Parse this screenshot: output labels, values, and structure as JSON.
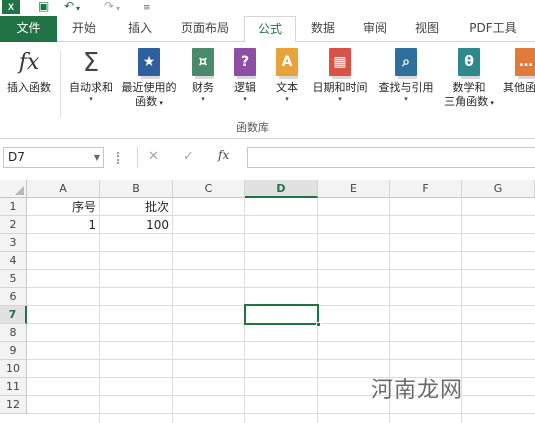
{
  "quick_access": {
    "app_icon": "excel-icon",
    "icons": [
      "save-icon",
      "undo-icon",
      "redo-icon",
      "customize-icon"
    ]
  },
  "tabs": [
    {
      "label": "文件",
      "state": "file"
    },
    {
      "label": "开始",
      "state": ""
    },
    {
      "label": "插入",
      "state": ""
    },
    {
      "label": "页面布局",
      "state": ""
    },
    {
      "label": "公式",
      "state": "active"
    },
    {
      "label": "数据",
      "state": ""
    },
    {
      "label": "审阅",
      "state": ""
    },
    {
      "label": "视图",
      "state": ""
    },
    {
      "label": "PDF工具",
      "state": ""
    }
  ],
  "ribbon": {
    "insert_function": {
      "icon_text": "fx",
      "label": "插入函数"
    },
    "autosum": {
      "icon_text": "Σ",
      "label": "自动求和"
    },
    "recent": {
      "icon_text": "★",
      "label1": "最近使用的",
      "label2": "函数"
    },
    "financial": {
      "icon_text": "¤",
      "label": "财务"
    },
    "logical": {
      "icon_text": "?",
      "label": "逻辑"
    },
    "text": {
      "icon_text": "A",
      "label": "文本"
    },
    "datetime": {
      "icon_text": "▦",
      "label": "日期和时间"
    },
    "lookup": {
      "icon_text": "⌕",
      "label": "查找与引用"
    },
    "math": {
      "icon_text": "θ",
      "label1": "数学和",
      "label2": "三角函数"
    },
    "more": {
      "icon_text": "…",
      "label": "其他函"
    },
    "group_label": "函数库",
    "colors": {
      "star": "#2e5f9e",
      "financial": "#4a8a6a",
      "logical": "#8e4ea5",
      "text": "#e8a23a",
      "datetime": "#d9524a",
      "lookup": "#2e6f9e",
      "math": "#2e8a8a",
      "more": "#e07b3a"
    }
  },
  "formula_bar": {
    "name_box": "D7",
    "cancel": "✕",
    "enter": "✓",
    "fx": "fx",
    "content": ""
  },
  "sheet": {
    "columns": [
      "A",
      "B",
      "C",
      "D",
      "E",
      "F",
      "G"
    ],
    "rows": [
      "1",
      "2",
      "3",
      "4",
      "5",
      "6",
      "7",
      "8",
      "9",
      "10",
      "11",
      "12"
    ],
    "selected_cell": "D7",
    "cells": {
      "A1": "序号",
      "B1": "批次",
      "A2": "1",
      "B2": "100"
    },
    "accent": "#217346"
  },
  "watermark": "河南龙网"
}
